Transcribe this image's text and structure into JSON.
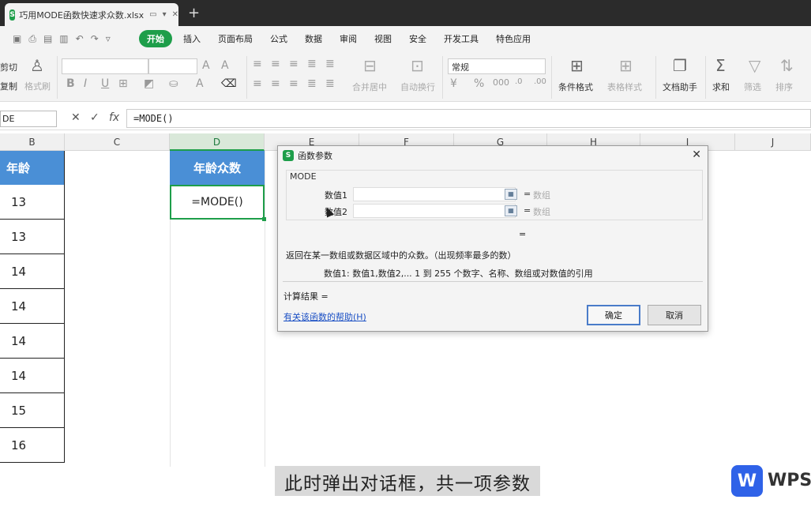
{
  "tab": {
    "icon": "S",
    "filename": "巧用MODE函数快速求众数.xlsx",
    "ctl_monitor": "▭",
    "ctl_more": "▾",
    "ctl_close": "✕",
    "new": "+"
  },
  "quick_icons": [
    "save-icon",
    "print-icon",
    "preview-icon",
    "undo-icon",
    "redo-icon",
    "more-icon"
  ],
  "menu": [
    "开始",
    "插入",
    "页面布局",
    "公式",
    "数据",
    "审阅",
    "视图",
    "安全",
    "开发工具",
    "特色应用"
  ],
  "ribbon": {
    "cut": "剪切",
    "copy": "复制",
    "format_painter": "格式刷",
    "merge": "合并居中",
    "wrap": "自动换行",
    "number_format": "常规",
    "cond_format": "条件格式",
    "table_style": "表格样式",
    "doc_helper": "文档助手",
    "sum": "求和",
    "filter": "筛选",
    "sort": "排序"
  },
  "formula_bar": {
    "namebox": "DE",
    "cancel": "✕",
    "confirm": "✓",
    "fx": "fx",
    "formula": "=MODE()"
  },
  "columns": [
    "B",
    "C",
    "D",
    "E",
    "F",
    "G",
    "H",
    "I",
    "J"
  ],
  "table_b": {
    "header": "年龄",
    "values": [
      "13",
      "13",
      "14",
      "14",
      "14",
      "14",
      "15",
      "16"
    ]
  },
  "table_d": {
    "header": "年龄众数",
    "value": "=MODE()"
  },
  "dialog": {
    "icon": "S",
    "title": "函数参数",
    "close": "✕",
    "function": "MODE",
    "args": [
      {
        "label": "数值1",
        "eq": "=",
        "hint": "数组"
      },
      {
        "label": "数值2",
        "eq": "=",
        "hint": "数组"
      }
    ],
    "result_eq": "=",
    "description": "返回在某一数组或数据区域中的众数。（出现频率最多的数）",
    "arg_description": "数值1:   数值1,数值2,... 1 到 255 个数字、名称、数组或对数值的引用",
    "calc_result": "计算结果  =",
    "help_link": "有关该函数的帮助(H)",
    "ok": "确定",
    "cancel": "取消"
  },
  "subtitle": "此时弹出对话框，共一项参数",
  "watermark": {
    "logo": "W",
    "text": "WPS"
  },
  "colors": {
    "accent_green": "#1e9e4a",
    "header_blue": "#4a8fd6",
    "link_blue": "#1a4fc4"
  }
}
